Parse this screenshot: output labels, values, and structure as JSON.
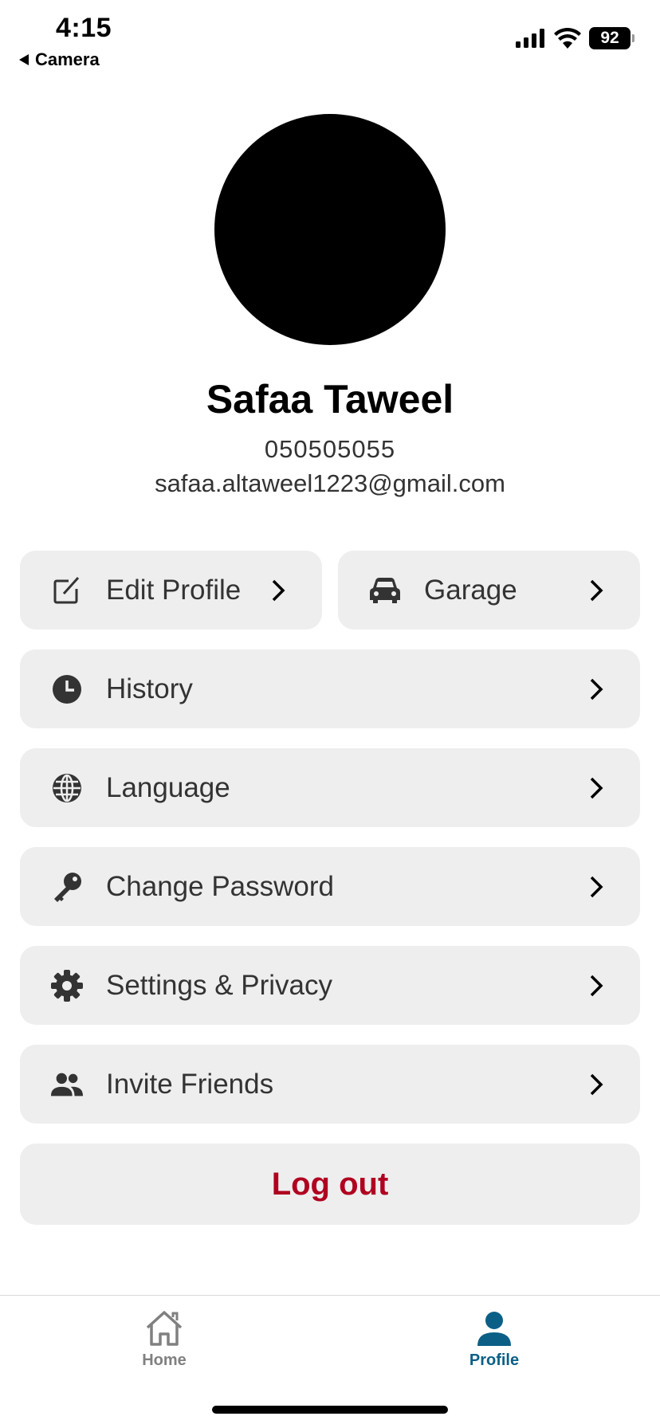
{
  "status_bar": {
    "time": "4:15",
    "back_app": "Camera",
    "battery": "92"
  },
  "profile": {
    "name": "Safaa Taweel",
    "phone": "050505055",
    "email": "safaa.altaweel1223@gmail.com"
  },
  "menu": {
    "edit_profile": "Edit Profile",
    "garage": "Garage",
    "history": "History",
    "language": "Language",
    "change_password": "Change Password",
    "settings_privacy": "Settings & Privacy",
    "invite_friends": "Invite Friends",
    "logout": "Log out"
  },
  "tabs": {
    "home": "Home",
    "profile": "Profile"
  },
  "colors": {
    "card_bg": "#eeeeee",
    "logout_text": "#b00020",
    "active_tab": "#0b5f87",
    "inactive_tab": "#808080"
  },
  "icons": {
    "edit_profile": "edit-square-icon",
    "garage": "car-icon",
    "history": "clock-icon",
    "language": "globe-icon",
    "change_password": "key-icon",
    "settings_privacy": "gear-icon",
    "invite_friends": "people-icon"
  }
}
